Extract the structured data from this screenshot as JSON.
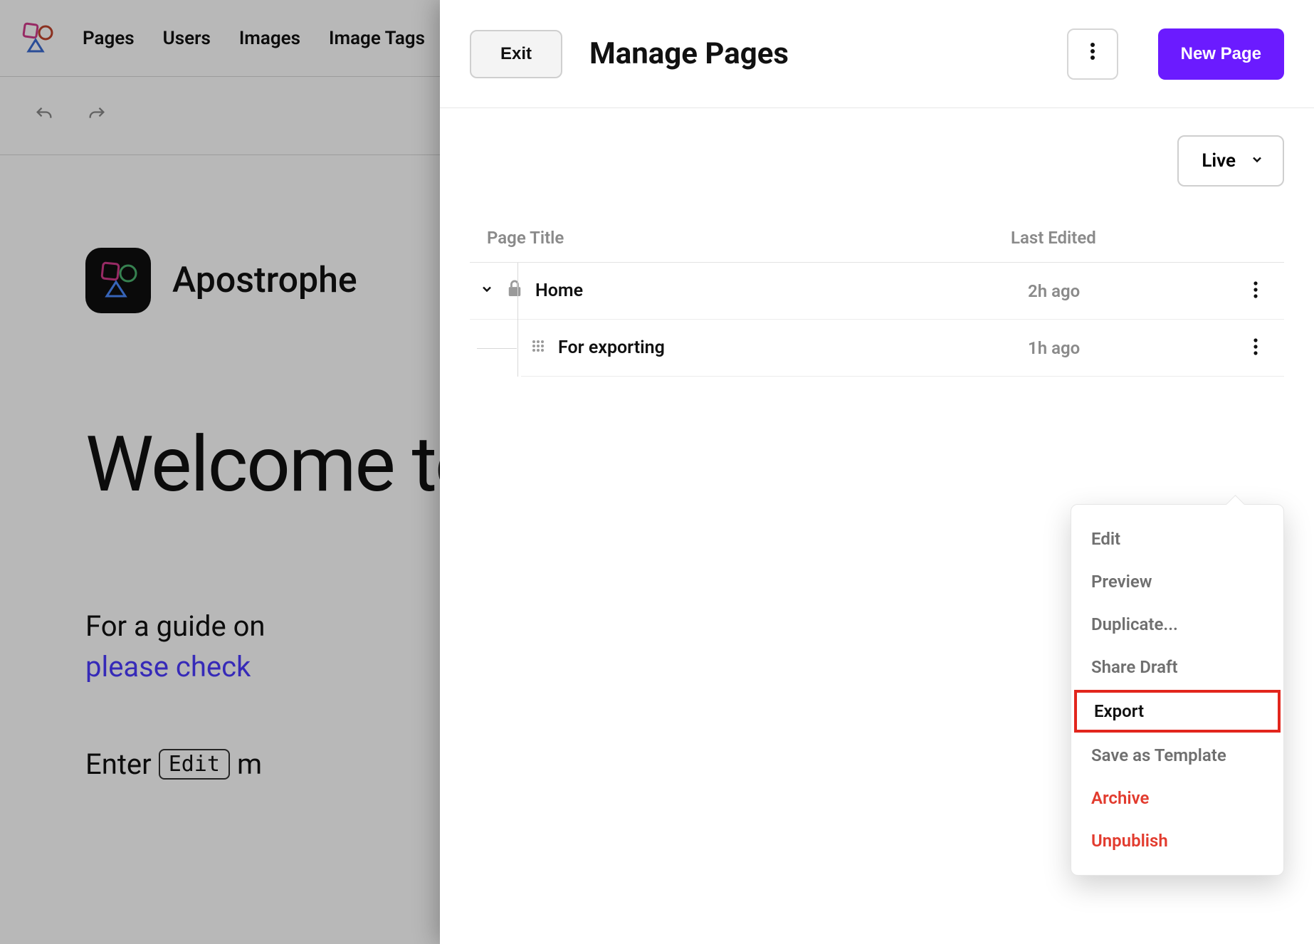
{
  "nav": {
    "items": [
      "Pages",
      "Users",
      "Images",
      "Image Tags"
    ]
  },
  "brand": {
    "name": "Apostrophe"
  },
  "page": {
    "welcome": "Welcome to",
    "guide_text": "For a guide on",
    "guide_link": "please check",
    "enter_prefix": "Enter",
    "enter_kbd": "Edit",
    "enter_suffix": "m"
  },
  "modal": {
    "exit_label": "Exit",
    "title": "Manage Pages",
    "new_page_label": "New Page",
    "filter_label": "Live",
    "columns": {
      "title": "Page Title",
      "edited": "Last Edited"
    },
    "rows": [
      {
        "title": "Home",
        "edited": "2h ago",
        "locked": true
      },
      {
        "title": "For exporting",
        "edited": "1h ago",
        "locked": false
      }
    ],
    "menu": {
      "edit": "Edit",
      "preview": "Preview",
      "duplicate": "Duplicate...",
      "share_draft": "Share Draft",
      "export": "Export",
      "save_template": "Save as Template",
      "archive": "Archive",
      "unpublish": "Unpublish"
    }
  }
}
